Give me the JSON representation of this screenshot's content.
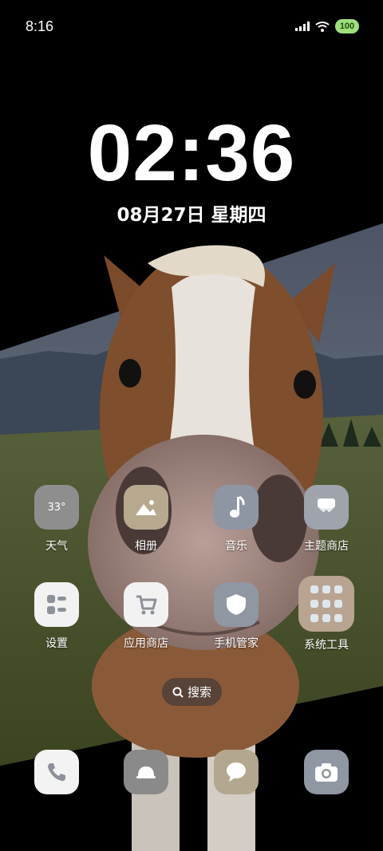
{
  "status": {
    "time": "8:16",
    "battery": "100"
  },
  "lock": {
    "clock": "02:36",
    "date": "08月27日 星期四"
  },
  "apps": {
    "weather": {
      "label": "天气",
      "temp": "33°"
    },
    "gallery": {
      "label": "相册"
    },
    "music": {
      "label": "音乐"
    },
    "theme_store": {
      "label": "主题商店"
    },
    "settings": {
      "label": "设置"
    },
    "app_store": {
      "label": "应用商店"
    },
    "phone_manager": {
      "label": "手机管家"
    },
    "system_tools": {
      "label": "系统工具"
    }
  },
  "search": {
    "label": "搜索"
  },
  "colors": {
    "weather_bg": "#8e8e8e",
    "gallery_bg": "#b7a98e",
    "music_bg": "#8e95a3",
    "theme_bg": "#9ea3ac",
    "settings_bg": "#f2f2f2",
    "appstore_bg": "#f2f2f2",
    "manager_bg": "#8f97a3",
    "tools_bg": "#b8a491",
    "phone_bg": "#f3f3f3",
    "dock2_bg": "#8a8a8a",
    "messages_bg": "#b3a88f",
    "camera_bg": "#8f97a3"
  },
  "icons": {
    "gallery": "mountain-icon",
    "music": "music-note-icon",
    "theme": "theme-icon",
    "settings": "settings-icon",
    "app_store": "cart-icon",
    "manager": "shield-icon",
    "tools": "folder-grid-icon",
    "phone": "phone-icon",
    "dock2": "bell-icon",
    "messages": "message-bubble-icon",
    "camera": "camera-icon",
    "search": "search-icon"
  }
}
